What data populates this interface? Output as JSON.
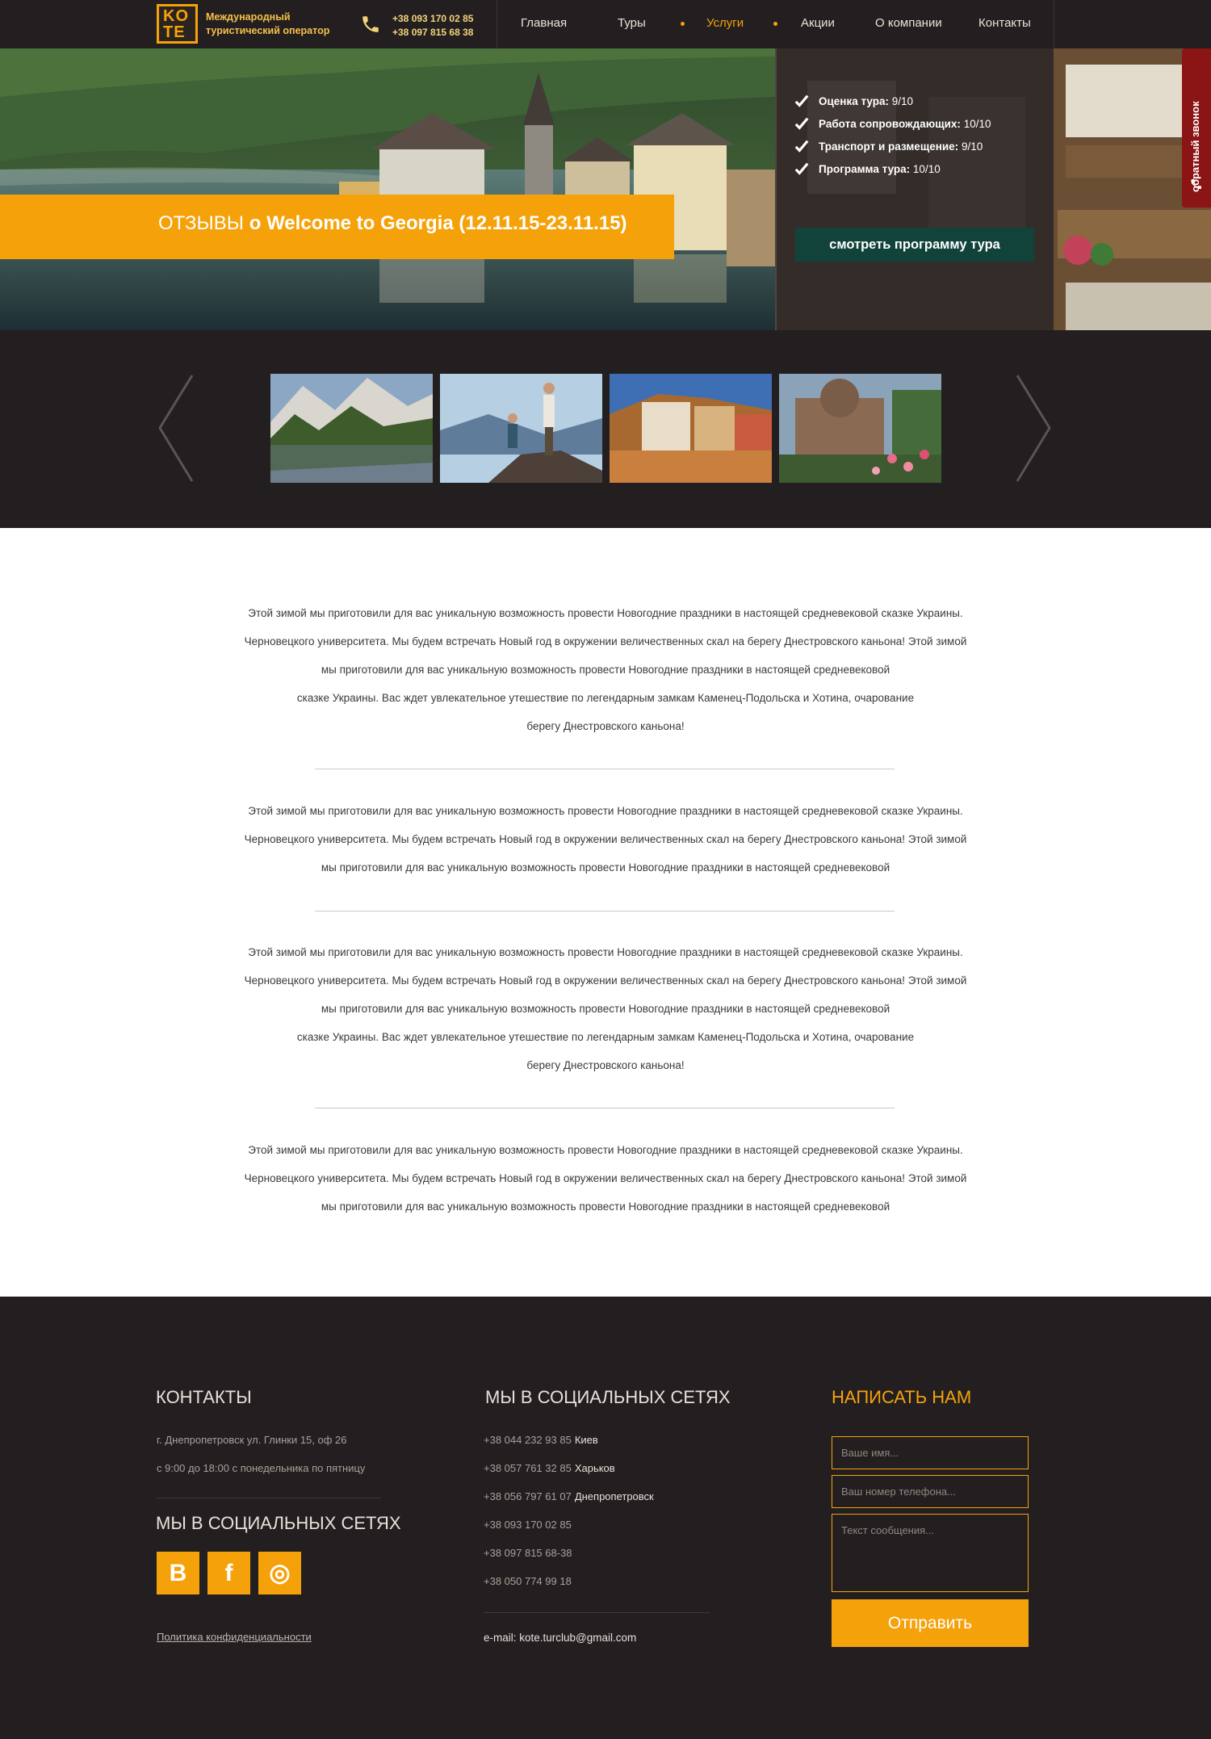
{
  "header": {
    "logo_line1": "KO",
    "logo_line2": "TE",
    "tagline_line1": "Международный",
    "tagline_line2": "туристический оператор",
    "phone1": "+38 093 170 02 85",
    "phone2": "+38 097 815 68 38",
    "nav": [
      {
        "label": "Главная",
        "active": false
      },
      {
        "label": "Туры",
        "active": false
      },
      {
        "label": "Услуги",
        "active": true
      },
      {
        "label": "Акции",
        "active": false
      },
      {
        "label": "О компании",
        "active": false
      },
      {
        "label": "Контакты",
        "active": false
      }
    ]
  },
  "hero": {
    "title_prefix": "ОТЗЫВЫ",
    "title_o": "о",
    "title_name": "Welcome to Georgia",
    "title_dates": "(12.11.15-23.11.15)",
    "ratings": [
      {
        "label": "Оценка тура:",
        "value": "9/10"
      },
      {
        "label": "Работа сопровождающих:",
        "value": "10/10"
      },
      {
        "label": "Транспорт и размещение:",
        "value": "9/10"
      },
      {
        "label": "Программа тура:",
        "value": "10/10"
      }
    ],
    "program_button": "смотреть программу тура",
    "callback_label": "обратный звонок"
  },
  "gallery": {
    "thumbnails": [
      "mountain-lake-photo",
      "hikers-photo",
      "old-town-photo",
      "monastery-photo"
    ]
  },
  "content": {
    "paragraphs": [
      [
        "Этой зимой мы приготовили для вас уникальную возможность провести Новогодние праздники в настоящей средневековой сказке Украины.",
        "Черновецкого университета. Мы будем встречать Новый год в окружении величественных скал на берегу Днестровского каньона! Этой зимой",
        "мы приготовили для вас уникальную возможность провести Новогодние праздники в настоящей средневековой",
        "сказке Украины. Вас ждет увлекательное утешествие по легендарным замкам Каменец-Подольска и Хотина, очарование",
        "берегу Днестровского каньона!"
      ],
      [
        "Этой зимой мы приготовили для вас уникальную возможность провести Новогодние праздники в настоящей средневековой сказке Украины.",
        "Черновецкого университета. Мы будем встречать Новый год в окружении величественных скал на берегу Днестровского каньона! Этой зимой",
        "мы приготовили для вас уникальную возможность провести Новогодние праздники в настоящей средневековой"
      ],
      [
        "Этой зимой мы приготовили для вас уникальную возможность провести Новогодние праздники в настоящей средневековой сказке Украины.",
        "Черновецкого университета. Мы будем встречать Новый год в окружении величественных скал на берегу Днестровского каньона! Этой зимой",
        "мы приготовили для вас уникальную возможность провести Новогодние праздники в настоящей средневековой",
        "сказке Украины. Вас ждет увлекательное утешествие по легендарным замкам Каменец-Подольска и Хотина, очарование",
        "берегу Днестровского каньона!"
      ],
      [
        "Этой зимой мы приготовили для вас уникальную возможность провести Новогодние праздники в настоящей средневековой сказке Украины.",
        "Черновецкого университета. Мы будем встречать Новый год в окружении величественных скал на берегу Днестровского каньона! Этой зимой",
        "мы приготовили для вас уникальную возможность провести Новогодние праздники в настоящей средневековой"
      ]
    ]
  },
  "footer": {
    "contacts_heading": "КОНТАКТЫ",
    "address": "г. Днепропетровск ул. Глинки 15, оф 26",
    "hours": "с 9:00 до 18:00 с понедельника по пятницу",
    "social_heading_left": "МЫ В СОЦИАЛЬНЫХ СЕТЯХ",
    "social_icons": [
      "vk-icon",
      "facebook-icon",
      "instagram-icon"
    ],
    "social_glyphs": [
      "B",
      "f",
      "◎"
    ],
    "policy_link": "Политика конфиденциальности",
    "social_heading_mid": "МЫ В СОЦИАЛЬНЫХ СЕТЯХ",
    "phones": [
      {
        "number": "+38 044 232 93 85",
        "city": "Киев"
      },
      {
        "number": "+38 057 761 32 85",
        "city": "Харьков"
      },
      {
        "number": "+38 056 797 61 07",
        "city": "Днепропетровск"
      },
      {
        "number": "+38 093 170 02 85",
        "city": ""
      },
      {
        "number": "+38 097 815 68-38",
        "city": ""
      },
      {
        "number": "+38 050 774 99 18",
        "city": ""
      }
    ],
    "email": "e-mail: kote.turclub@gmail.com",
    "write_heading": "НАПИСАТЬ НАМ",
    "form": {
      "name_placeholder": "Ваше имя...",
      "phone_placeholder": "Ваш номер телефона...",
      "message_placeholder": "Текст сообщения...",
      "submit_label": "Отправить"
    }
  },
  "colors": {
    "accent": "#f5a20a",
    "dark": "#231f20",
    "button_green": "#11433b",
    "callback_red": "#8b1414"
  }
}
